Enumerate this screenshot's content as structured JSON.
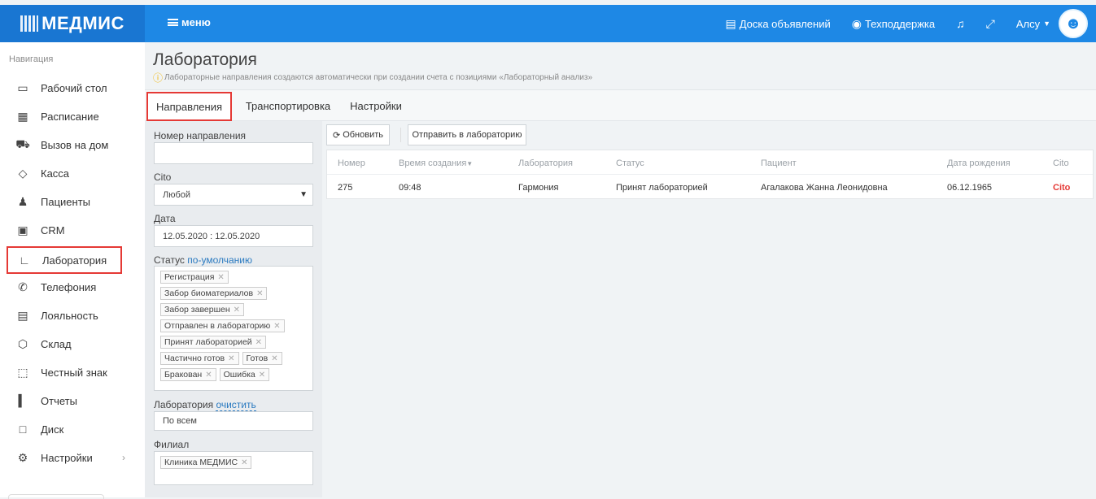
{
  "topbar": {
    "brand": "МЕДМИС",
    "menu_label": "меню",
    "board_label": "Доска объявлений",
    "support_label": "Техподдержка",
    "user_label": "Алсу"
  },
  "sidebar": {
    "heading": "Навигация",
    "items": [
      {
        "label": "Рабочий стол",
        "icon": "monitor-icon"
      },
      {
        "label": "Расписание",
        "icon": "calendar-icon"
      },
      {
        "label": "Вызов на дом",
        "icon": "ambulance-icon"
      },
      {
        "label": "Касса",
        "icon": "cash-icon"
      },
      {
        "label": "Пациенты",
        "icon": "patients-icon"
      },
      {
        "label": "CRM",
        "icon": "crm-icon"
      },
      {
        "label": "Лаборатория",
        "icon": "microscope-icon"
      },
      {
        "label": "Телефония",
        "icon": "phone-icon"
      },
      {
        "label": "Лояльность",
        "icon": "gift-icon"
      },
      {
        "label": "Склад",
        "icon": "box-icon"
      },
      {
        "label": "Честный знак",
        "icon": "scan-icon"
      },
      {
        "label": "Отчеты",
        "icon": "chart-icon"
      },
      {
        "label": "Диск",
        "icon": "folder-icon"
      },
      {
        "label": "Настройки",
        "icon": "gear-icon"
      }
    ]
  },
  "header": {
    "title": "Лаборатория",
    "note": "Лабораторные направления создаются автоматически при создании счета с позициями «Лабораторный анализ»"
  },
  "tabs": [
    "Направления",
    "Транспортировка",
    "Настройки"
  ],
  "filters": {
    "number_label": "Номер направления",
    "number_value": "",
    "cito_label": "Cito",
    "cito_value": "Любой",
    "date_label": "Дата",
    "date_value": "12.05.2020 : 12.05.2020",
    "status_label": "Статус",
    "status_link": "по-умолчанию",
    "status_tags": [
      "Регистрация",
      "Забор биоматериалов",
      "Забор завершен",
      "Отправлен в лабораторию",
      "Принят лабораторией",
      "Частично готов",
      "Готов",
      "Бракован",
      "Ошибка"
    ],
    "lab_label": "Лаборатория",
    "lab_link": "очистить",
    "lab_value": "По всем",
    "branch_label": "Филиал",
    "branch_tags": [
      "Клиника МЕДМИС"
    ]
  },
  "toolbar": {
    "refresh_label": "Обновить",
    "send_label": "Отправить в лабораторию"
  },
  "table": {
    "columns": [
      "Номер",
      "Время создания",
      "Лаборатория",
      "Статус",
      "Пациент",
      "Дата рождения",
      "Cito"
    ],
    "rows": [
      [
        "275",
        "09:48",
        "Гармония",
        "Принят лабораторией",
        "Агалакова Жанна Леонидовна",
        "06.12.1965",
        "Cito"
      ]
    ]
  },
  "colors": {
    "topbar": "#1e88e5",
    "brand_bg": "#1976d2",
    "highlight": "#e53935",
    "cito": "#e53935",
    "link": "#2a7ac0"
  }
}
